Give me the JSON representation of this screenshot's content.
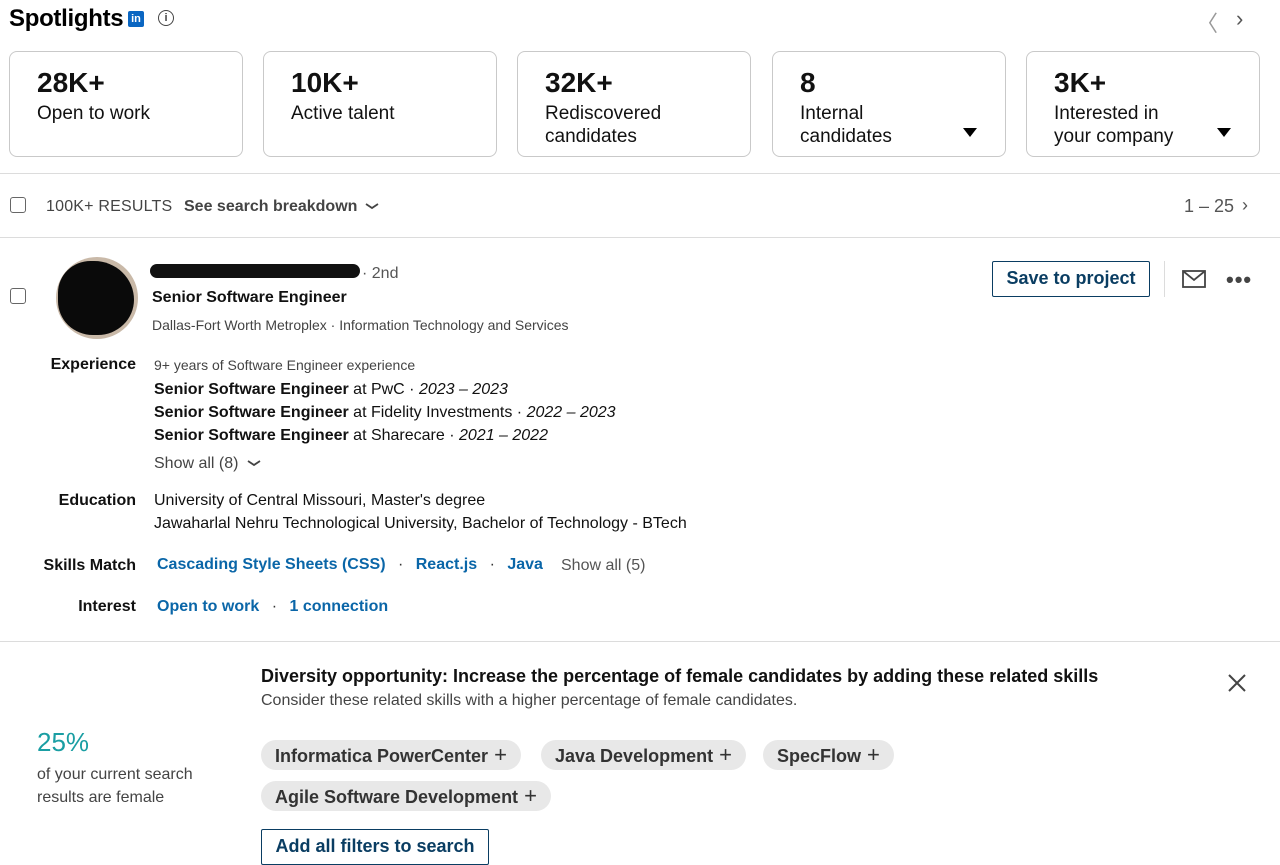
{
  "header": {
    "title": "Spotlights",
    "linkedin_badge": "in",
    "info_icon": "info-icon",
    "prev_glyph": "〈",
    "next_glyph": "›"
  },
  "spotlights": [
    {
      "number": "28K+",
      "label": "Open to work",
      "dropdown": false
    },
    {
      "number": "10K+",
      "label": "Active talent",
      "dropdown": false
    },
    {
      "number": "32K+",
      "label": "Rediscovered candidates",
      "dropdown": false
    },
    {
      "number": "8",
      "label": "Internal candidates",
      "dropdown": true
    },
    {
      "number": "3K+",
      "label": "Interested in your company",
      "dropdown": true
    }
  ],
  "results_bar": {
    "count": "100K+ RESULTS",
    "breakdown": "See search breakdown",
    "pager": "1 – 25"
  },
  "candidate": {
    "degree": "· 2nd",
    "headline": "Senior Software Engineer",
    "location": "Dallas-Fort Worth Metroplex · Information Technology and Services",
    "save_label": "Save to project",
    "experience": {
      "label": "Experience",
      "summary": "9+ years of Software Engineer experience",
      "items": [
        {
          "title": "Senior Software Engineer",
          "company": " at PwC · ",
          "dates": "2023 – 2023"
        },
        {
          "title": "Senior Software Engineer",
          "company": " at Fidelity Investments · ",
          "dates": "2022 – 2023"
        },
        {
          "title": "Senior Software Engineer",
          "company": " at Sharecare · ",
          "dates": "2021 – 2022"
        }
      ],
      "show_all": "Show all (8)"
    },
    "education": {
      "label": "Education",
      "items": [
        "University of Central Missouri, Master's degree",
        "Jawaharlal Nehru Technological University, Bachelor of Technology - BTech"
      ]
    },
    "skills": {
      "label": "Skills Match",
      "items": [
        "Cascading Style Sheets (CSS)",
        "React.js",
        "Java"
      ],
      "show_all": "Show all (5)"
    },
    "interest": {
      "label": "Interest",
      "items": [
        "Open to work",
        "1 connection"
      ]
    }
  },
  "diversity": {
    "title": "Diversity opportunity: Increase the percentage of female candidates by adding these related skills",
    "subtitle": "Consider these related skills with a higher percentage of female candidates.",
    "percent": "25%",
    "percent_text": "of your current search results are female",
    "skills": [
      "Informatica PowerCenter",
      "Java Development",
      "SpecFlow",
      "Agile Software Development"
    ],
    "add_all": "Add all filters to search"
  },
  "colors": {
    "link_blue": "#0a66a8",
    "button_navy": "#0a3d62",
    "teal_percent": "#1a9ea3",
    "linkedin_blue": "#0a66c2"
  }
}
